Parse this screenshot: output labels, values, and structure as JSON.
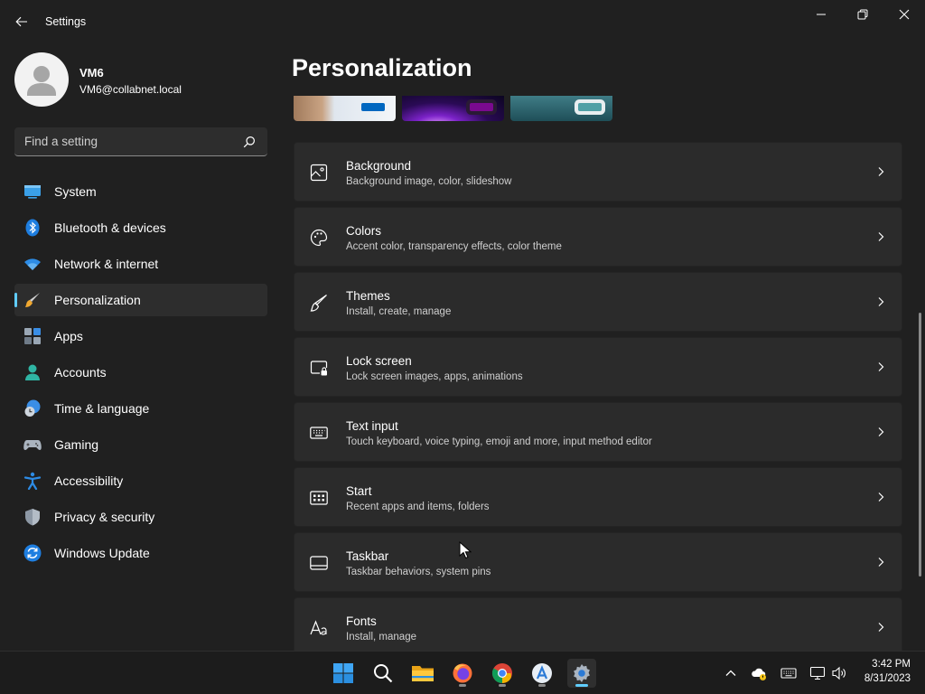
{
  "window": {
    "title": "Settings"
  },
  "profile": {
    "name": "VM6",
    "email": "VM6@collabnet.local"
  },
  "search": {
    "placeholder": "Find a setting"
  },
  "sidebar": {
    "items": [
      {
        "label": "System",
        "icon": "system-icon",
        "active": false
      },
      {
        "label": "Bluetooth & devices",
        "icon": "bluetooth-icon",
        "active": false
      },
      {
        "label": "Network & internet",
        "icon": "wifi-icon",
        "active": false
      },
      {
        "label": "Personalization",
        "icon": "brush-icon",
        "active": true
      },
      {
        "label": "Apps",
        "icon": "apps-icon",
        "active": false
      },
      {
        "label": "Accounts",
        "icon": "accounts-icon",
        "active": false
      },
      {
        "label": "Time & language",
        "icon": "clock-globe-icon",
        "active": false
      },
      {
        "label": "Gaming",
        "icon": "gamepad-icon",
        "active": false
      },
      {
        "label": "Accessibility",
        "icon": "accessibility-icon",
        "active": false
      },
      {
        "label": "Privacy & security",
        "icon": "shield-icon",
        "active": false
      },
      {
        "label": "Windows Update",
        "icon": "update-icon",
        "active": false
      }
    ]
  },
  "main": {
    "title": "Personalization",
    "themes": [
      {
        "name": "theme-1",
        "accent": "#0067c0"
      },
      {
        "name": "theme-2",
        "accent": "#7a0a8f"
      },
      {
        "name": "theme-3",
        "accent": "#4fa0a6"
      }
    ],
    "cards": [
      {
        "title": "Background",
        "subtitle": "Background image, color, slideshow",
        "icon": "image-icon"
      },
      {
        "title": "Colors",
        "subtitle": "Accent color, transparency effects, color theme",
        "icon": "palette-icon"
      },
      {
        "title": "Themes",
        "subtitle": "Install, create, manage",
        "icon": "brush-icon"
      },
      {
        "title": "Lock screen",
        "subtitle": "Lock screen images, apps, animations",
        "icon": "lock-screen-icon"
      },
      {
        "title": "Text input",
        "subtitle": "Touch keyboard, voice typing, emoji and more, input method editor",
        "icon": "keyboard-icon"
      },
      {
        "title": "Start",
        "subtitle": "Recent apps and items, folders",
        "icon": "start-icon"
      },
      {
        "title": "Taskbar",
        "subtitle": "Taskbar behaviors, system pins",
        "icon": "taskbar-icon"
      },
      {
        "title": "Fonts",
        "subtitle": "Install, manage",
        "icon": "fonts-icon"
      }
    ]
  },
  "taskbar": {
    "apps": [
      "start-icon",
      "search-icon",
      "file-explorer-icon",
      "firefox-icon",
      "chrome-icon",
      "app-store-icon",
      "settings-icon"
    ],
    "time": "3:42 PM",
    "date": "8/31/2023"
  },
  "colors": {
    "accent": "#60cdff",
    "background": "#202020",
    "card": "#2b2b2b"
  }
}
